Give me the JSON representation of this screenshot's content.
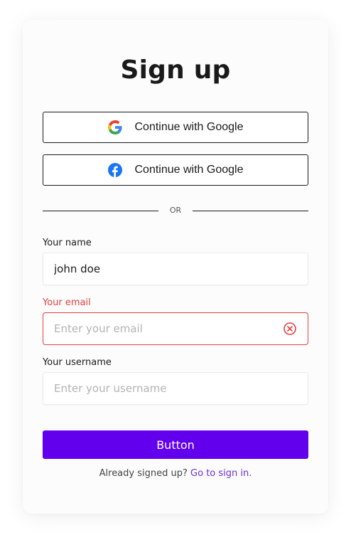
{
  "title": "Sign up",
  "social": {
    "google_label": "Continue with Google",
    "facebook_label": "Continue with Google"
  },
  "divider_text": "OR",
  "fields": {
    "name": {
      "label": "Your name",
      "value": "john doe",
      "placeholder": ""
    },
    "email": {
      "label": "Your email",
      "value": "",
      "placeholder": "Enter your email",
      "state": "error"
    },
    "username": {
      "label": "Your username",
      "value": "",
      "placeholder": "Enter your username"
    }
  },
  "submit_label": "Button",
  "footer": {
    "text": "Already signed up?",
    "link": "Go to sign in."
  },
  "colors": {
    "accent": "#6200ee",
    "error": "#e53e3e",
    "link": "#6b2fd6"
  }
}
